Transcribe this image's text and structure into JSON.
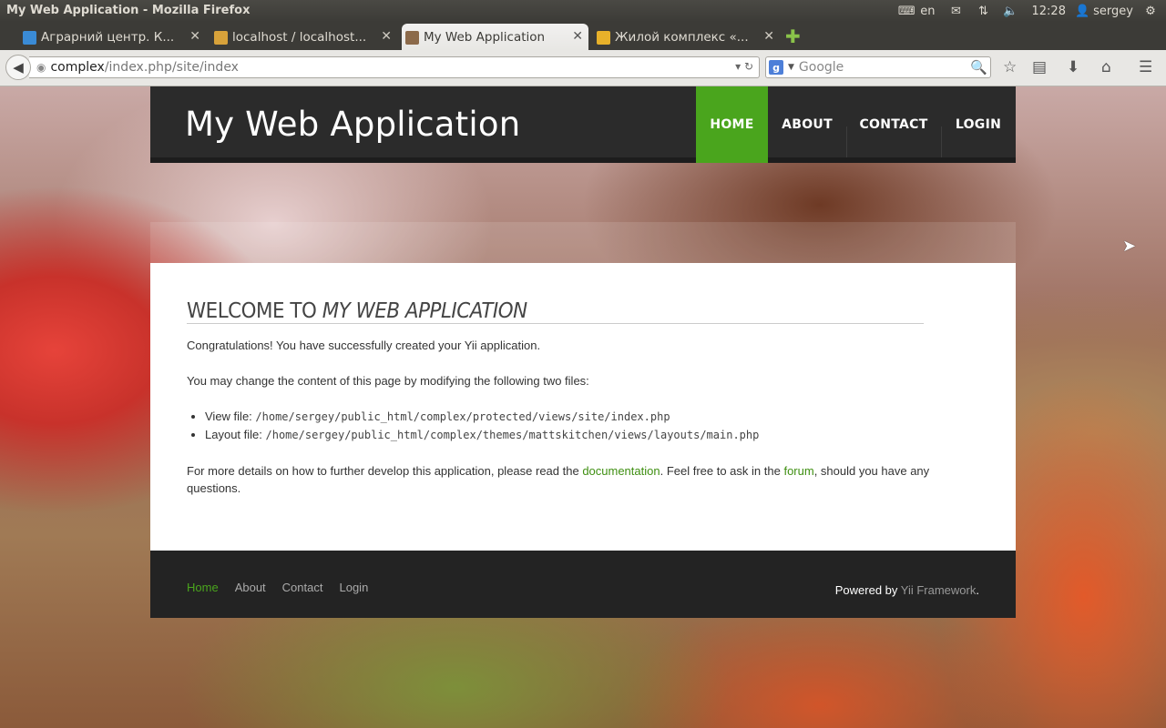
{
  "os": {
    "window_title": "My Web Application - Mozilla Firefox",
    "keyboard_layout": "en",
    "clock": "12:28",
    "user": "sergey"
  },
  "tabs": [
    {
      "title": "Аграрний центр. К...",
      "active": false,
      "favicon_color": "#3a8bd6"
    },
    {
      "title": "localhost / localhost...",
      "active": false,
      "favicon_color": "#d8a23a"
    },
    {
      "title": "My Web Application",
      "active": true,
      "favicon_color": "#8c6a4a"
    },
    {
      "title": "Жилой комплекс «...",
      "active": false,
      "favicon_color": "#e8b12a"
    }
  ],
  "toolbar": {
    "url_host": "complex",
    "url_path": "/index.php/site/index",
    "search_placeholder": "Google"
  },
  "site": {
    "logo": "My Web Application",
    "menu": [
      {
        "label": "HOME",
        "active": true
      },
      {
        "label": "ABOUT",
        "active": false
      },
      {
        "label": "CONTACT",
        "active": false
      },
      {
        "label": "LOGIN",
        "active": false
      }
    ],
    "content": {
      "heading_prefix": "Welcome to ",
      "heading_app": "My Web Application",
      "p1": "Congratulations! You have successfully created your Yii application.",
      "p2": "You may change the content of this page by modifying the following two files:",
      "files": [
        {
          "label": "View file: ",
          "path": "/home/sergey/public_html/complex/protected/views/site/index.php"
        },
        {
          "label": "Layout file: ",
          "path": "/home/sergey/public_html/complex/themes/mattskitchen/views/layouts/main.php"
        }
      ],
      "p3_a": "For more details on how to further develop this application, please read the ",
      "link_docs": "documentation",
      "p3_b": ". Feel free to ask in the ",
      "link_forum": "forum",
      "p3_c": ", should you have any questions."
    },
    "footer": {
      "menu": [
        {
          "label": "Home",
          "active": true
        },
        {
          "label": "About",
          "active": false
        },
        {
          "label": "Contact",
          "active": false
        },
        {
          "label": "Login",
          "active": false
        }
      ],
      "powered_prefix": "Powered by ",
      "powered_link": "Yii Framework",
      "powered_suffix": "."
    }
  },
  "colors": {
    "accent_green": "#4aa51d",
    "header_bg": "#2b2b2b",
    "footer_bg": "#232323"
  }
}
